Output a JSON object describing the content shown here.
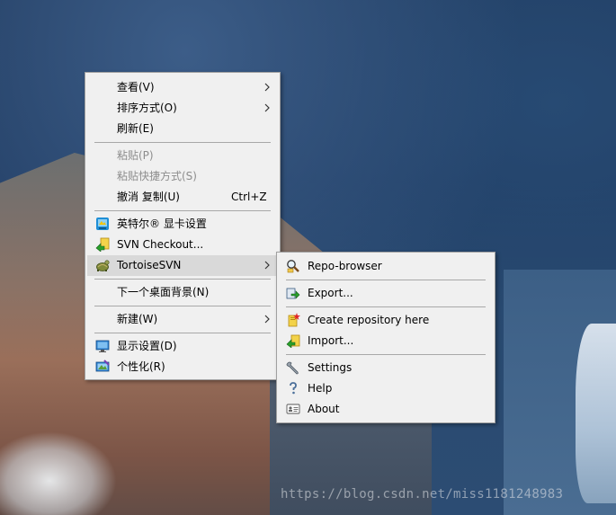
{
  "colors": {
    "menu_background": "#f0f0f0",
    "menu_border": "#a0a0a0",
    "highlight": "#d9d9d9",
    "disabled_text": "#8d8d8d"
  },
  "desktop_menu": {
    "items": [
      {
        "label": "查看(V)",
        "submenu": true
      },
      {
        "label": "排序方式(O)",
        "submenu": true
      },
      {
        "label": "刷新(E)"
      },
      {
        "label": "粘贴(P)",
        "disabled": true
      },
      {
        "label": "粘贴快捷方式(S)",
        "disabled": true
      },
      {
        "label": "撤消 复制(U)",
        "shortcut": "Ctrl+Z"
      },
      {
        "label": "英特尔® 显卡设置",
        "icon": "intel-graphics-icon"
      },
      {
        "label": "SVN Checkout...",
        "icon": "svn-checkout-icon"
      },
      {
        "label": "TortoiseSVN",
        "icon": "tortoisesvn-icon",
        "submenu": true,
        "highlighted": true
      },
      {
        "label": "下一个桌面背景(N)"
      },
      {
        "label": "新建(W)",
        "submenu": true
      },
      {
        "label": "显示设置(D)",
        "icon": "display-settings-icon"
      },
      {
        "label": "个性化(R)",
        "icon": "personalize-icon"
      }
    ]
  },
  "tortoisesvn_submenu": {
    "items": [
      {
        "label": "Repo-browser",
        "icon": "repo-browser-icon"
      },
      {
        "label": "Export...",
        "icon": "export-icon"
      },
      {
        "label": "Create repository here",
        "icon": "create-repository-icon"
      },
      {
        "label": "Import...",
        "icon": "import-icon"
      },
      {
        "label": "Settings",
        "icon": "settings-wrench-icon"
      },
      {
        "label": "Help",
        "icon": "help-icon"
      },
      {
        "label": "About",
        "icon": "about-icon"
      }
    ]
  },
  "watermark": "https://blog.csdn.net/miss1181248983"
}
